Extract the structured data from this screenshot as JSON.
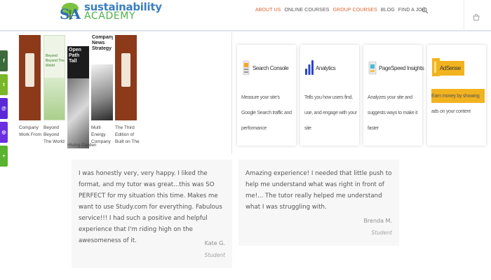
{
  "header": {
    "logo": {
      "line1": "sustainability",
      "line2": "ACADEMY",
      "mark_letters": "SA"
    },
    "nav": [
      {
        "label": "ABOUT US",
        "accent": true
      },
      {
        "label": "ONLINE COURSES",
        "accent": false
      },
      {
        "label": "GROUP COURSES",
        "accent": true
      },
      {
        "label": "BLOG",
        "accent": false
      },
      {
        "label": "FIND A JOB",
        "accent": false
      }
    ],
    "search_icon": "search-icon",
    "cart_icon": "cart-icon"
  },
  "social": [
    {
      "icon": "facebook-icon",
      "glyph": "f",
      "color": "#3d6a3a"
    },
    {
      "icon": "twitter-icon",
      "glyph": "t",
      "color": "#79b728"
    },
    {
      "icon": "email-icon",
      "glyph": "@",
      "color": "#5b2ad6"
    },
    {
      "icon": "instagram-icon",
      "glyph": "◎",
      "color": "#6b2fe0"
    },
    {
      "icon": "share-icon",
      "glyph": "+",
      "color": "#59b32e"
    }
  ],
  "books": [
    {
      "caption": "Company Work From",
      "cover_color": "#8c3a1a",
      "cover_text": ""
    },
    {
      "caption": "Beyond Beyond The World",
      "cover_color": "#eef5e6",
      "cover_text": "Beyond Beyond The World"
    },
    {
      "caption": "Hiving Garden",
      "cover_color": "#1c1c1c",
      "cover_text": "Open Path Tall"
    },
    {
      "caption": "Multi Energy Company",
      "cover_color": "#2a2a2a",
      "cover_text": "Company News Strategy"
    },
    {
      "caption": "The Third Edition of Built on The",
      "cover_color": "#8c3a1a",
      "cover_text": ""
    }
  ],
  "tools": [
    {
      "title": "Search Console",
      "desc": "Measure your site's Google Search traffic and performance",
      "icon": "search-console-icon",
      "icon_color": "#f6a623"
    },
    {
      "title": "Analytics",
      "desc": "Tells you how users find, use, and engage with your site",
      "icon": "analytics-icon",
      "icon_color": "#2b45c9"
    },
    {
      "title": "PageSpeed Insights",
      "desc": "Analyzes your site and suggests ways to make it faster",
      "icon": "pagespeed-icon",
      "icon_color": "#4cb8d6"
    },
    {
      "title": "AdSense",
      "desc": "Earn money by showing ads on your content",
      "icon": "adsense-icon",
      "icon_color": "#f2b320"
    }
  ],
  "testimonials": [
    {
      "quote": "I was honestly very, very happy. I liked the format, and my tutor was great...this was SO PERFECT for my situation this time. Makes me want to use Study.com for everything. Fabulous service!!! I had such a positive and helpful experience that I'm riding high on the awesomeness of it.",
      "name": "Kate G.",
      "role": "Student"
    },
    {
      "quote": "Amazing experience! I needed that little push to help me understand what was right in front of me!... The tutor really helped me understand what I was struggling with.",
      "name": "Brenda M.",
      "role": "Student"
    }
  ]
}
